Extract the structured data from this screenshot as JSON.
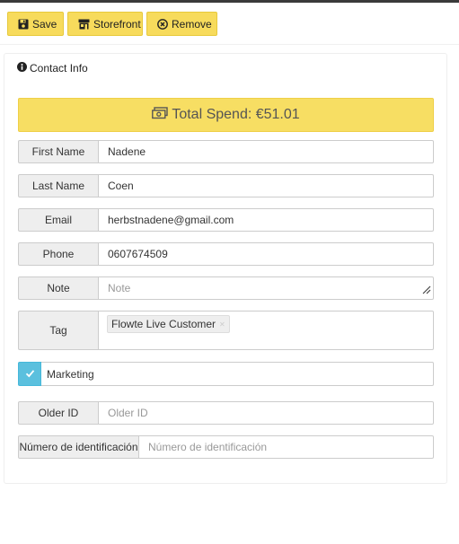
{
  "toolbar": {
    "save_label": "Save",
    "storefront_label": "Storefront",
    "remove_label": "Remove"
  },
  "panel": {
    "heading": "Contact Info",
    "total_spend": "Total Spend: €51.01"
  },
  "fields": {
    "first_name": {
      "label": "First Name",
      "value": "Nadene"
    },
    "last_name": {
      "label": "Last Name",
      "value": "Coen"
    },
    "email": {
      "label": "Email",
      "value": "herbstnadene@gmail.com"
    },
    "phone": {
      "label": "Phone",
      "value": "0607674509"
    },
    "note": {
      "label": "Note",
      "placeholder": "Note",
      "value": ""
    },
    "tag": {
      "label": "Tag",
      "tags": [
        "Flowte Live Customer"
      ]
    },
    "marketing": {
      "label": "Marketing",
      "checked": true
    },
    "older_id": {
      "label": "Older ID",
      "placeholder": "Older  ID",
      "value": ""
    },
    "id_number": {
      "label": "Número de identificación",
      "placeholder": "Número de identificación",
      "value": ""
    }
  },
  "colors": {
    "accent_yellow": "#f7db5c",
    "check_blue": "#5bc0de"
  },
  "icons": {
    "save": "floppy-disk-icon",
    "storefront": "store-icon",
    "remove": "circle-x-icon",
    "info": "info-circle-icon",
    "money": "money-bill-icon",
    "check": "check-icon",
    "resize": "resize-handle-icon"
  }
}
